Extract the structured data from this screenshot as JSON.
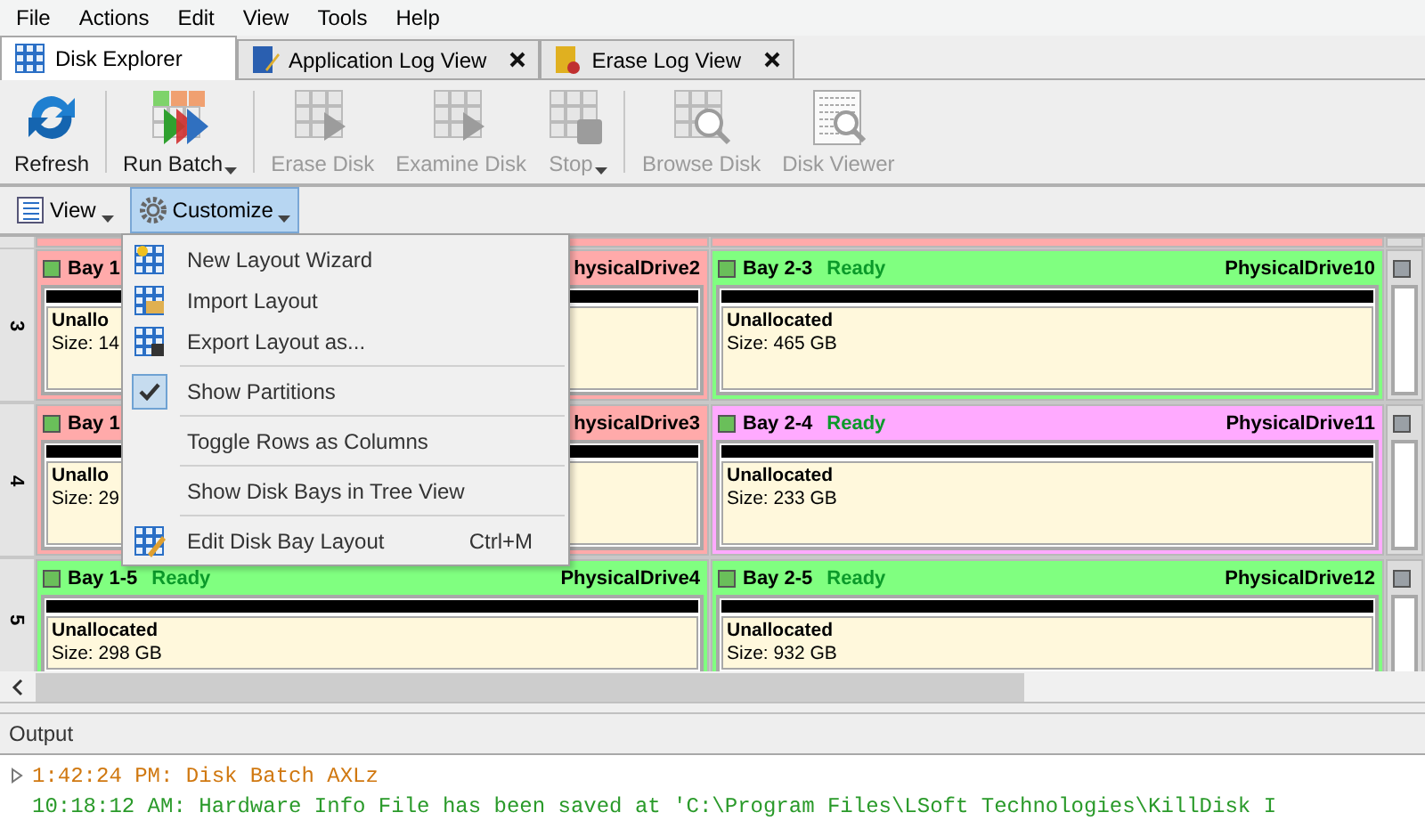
{
  "menu_bar": [
    "File",
    "Actions",
    "Edit",
    "View",
    "Tools",
    "Help"
  ],
  "tabs": [
    {
      "label": "Disk Explorer",
      "selected": true,
      "closable": false,
      "kind": "grid"
    },
    {
      "label": "Application Log View",
      "selected": false,
      "closable": true,
      "kind": "log"
    },
    {
      "label": "Erase Log View",
      "selected": false,
      "closable": true,
      "kind": "erase"
    }
  ],
  "toolbar": [
    {
      "label": "Refresh",
      "kind": "refresh",
      "disabled": false,
      "dropdown": false
    },
    {
      "label": "Run Batch",
      "kind": "run",
      "disabled": false,
      "dropdown": true
    },
    {
      "label": "Erase Disk",
      "kind": "play",
      "disabled": true,
      "dropdown": false
    },
    {
      "label": "Examine Disk",
      "kind": "play",
      "disabled": true,
      "dropdown": false
    },
    {
      "label": "Stop",
      "kind": "stop",
      "disabled": true,
      "dropdown": true
    },
    {
      "label": "Browse Disk",
      "kind": "browse",
      "disabled": true,
      "dropdown": false
    },
    {
      "label": "Disk Viewer",
      "kind": "viewer",
      "disabled": true,
      "dropdown": false
    }
  ],
  "view_toolbar": [
    {
      "label": "View",
      "kind": "view",
      "pressed": false
    },
    {
      "label": "Customize",
      "kind": "gear",
      "pressed": true
    }
  ],
  "customize_menu": [
    {
      "kind": "wizard",
      "label": "New Layout Wizard"
    },
    {
      "kind": "import",
      "label": "Import Layout"
    },
    {
      "kind": "export",
      "label": "Export Layout as..."
    },
    {
      "kind": "separator"
    },
    {
      "kind": "toggle",
      "label": "Show Partitions",
      "checked": true
    },
    {
      "kind": "separator"
    },
    {
      "kind": "plain",
      "label": "Toggle Rows as Columns"
    },
    {
      "kind": "separator"
    },
    {
      "kind": "plain",
      "label": "Show Disk Bays in Tree View"
    },
    {
      "kind": "separator"
    },
    {
      "kind": "edit",
      "label": "Edit Disk Bay Layout",
      "shortcut": "Ctrl+M"
    }
  ],
  "disk_grid": {
    "rows": [
      {
        "kind": "strip",
        "bays": [
          {
            "color": "#ffaaaa"
          },
          {
            "color": "#ffaaaa"
          },
          {
            "color": "#dcdcdc"
          }
        ]
      },
      {
        "kind": "full",
        "label": "3",
        "bays": [
          {
            "title": "Bay 1",
            "drive": "hysicalDrive2",
            "partition": "Unallo",
            "size": "Size: 14",
            "color": "#ffaaaa"
          },
          {
            "title": "Bay 2-3",
            "status": "Ready",
            "drive": "PhysicalDrive10",
            "partition": "Unallocated",
            "size": "Size: 465 GB",
            "color": "#80ff80"
          },
          {
            "color": "#dcdcdc"
          }
        ]
      },
      {
        "kind": "full",
        "label": "4",
        "bays": [
          {
            "title": "Bay 1",
            "drive": "hysicalDrive3",
            "partition": "Unallo",
            "size": "Size: 29",
            "color": "#ffaaaa"
          },
          {
            "title": "Bay 2-4",
            "status": "Ready",
            "drive": "PhysicalDrive11",
            "partition": "Unallocated",
            "size": "Size: 233 GB",
            "color": "#ffaaff"
          },
          {
            "color": "#dcdcdc"
          }
        ]
      },
      {
        "kind": "full",
        "label": "5",
        "bays": [
          {
            "title": "Bay 1-5",
            "status": "Ready",
            "drive": "PhysicalDrive4",
            "partition": "Unallocated",
            "size": "Size: 298 GB",
            "color": "#80ff80"
          },
          {
            "title": "Bay 2-5",
            "status": "Ready",
            "drive": "PhysicalDrive12",
            "partition": "Unallocated",
            "size": "Size: 932 GB",
            "color": "#80ff80"
          },
          {
            "color": "#dcdcdc"
          }
        ]
      }
    ]
  },
  "output": {
    "title": "Output",
    "lines": [
      {
        "text": "1:42:24 PM: Disk Batch AXLz",
        "color": "#d07810",
        "expandable": true
      },
      {
        "text": "10:18:12 AM: Hardware Info File has been saved at 'C:\\Program Files\\LSoft Technologies\\KillDisk I",
        "color": "#2a9a2a",
        "expandable": false
      }
    ]
  }
}
